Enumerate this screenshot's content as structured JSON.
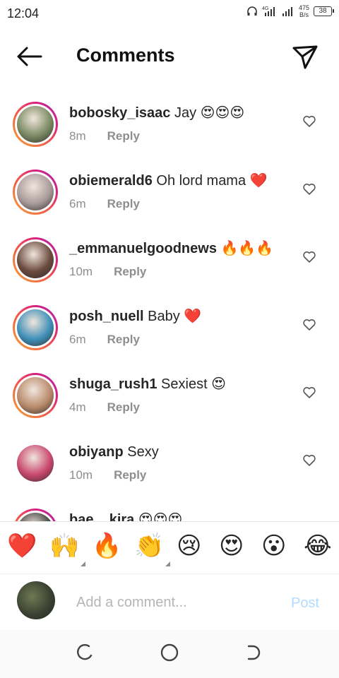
{
  "status_bar": {
    "time": "12:04",
    "network": "4G",
    "speed_value": "475",
    "speed_unit": "B/s",
    "battery": "38"
  },
  "header": {
    "title": "Comments",
    "back_icon": "arrow-left-icon",
    "share_icon": "paper-plane-icon"
  },
  "comments": [
    {
      "username": "bobosky_isaac",
      "text": " Jay 😍😍😍",
      "time": "8m",
      "reply": "Reply",
      "story_ring": true,
      "avatar_color": "#7a8a63"
    },
    {
      "username": "obiemerald6",
      "text": " Oh lord mama ❤️",
      "time": "6m",
      "reply": "Reply",
      "story_ring": true,
      "avatar_color": "#a89a9a"
    },
    {
      "username": "_emmanuelgoodnews",
      "text": " 🔥🔥🔥",
      "time": "10m",
      "reply": "Reply",
      "story_ring": true,
      "avatar_color": "#6b4a3e"
    },
    {
      "username": "posh_nuell",
      "text": " Baby ❤️",
      "time": "6m",
      "reply": "Reply",
      "story_ring": true,
      "avatar_color": "#3f8fb8"
    },
    {
      "username": "shuga_rush1",
      "text": " Sexiest 😍",
      "time": "4m",
      "reply": "Reply",
      "story_ring": true,
      "avatar_color": "#b98a6b"
    },
    {
      "username": "obiyanp",
      "text": " Sexy",
      "time": "10m",
      "reply": "Reply",
      "story_ring": false,
      "avatar_color": "#c9476e"
    },
    {
      "username": "bae__kira",
      "text": " 😍😍😍",
      "time": "",
      "reply": "",
      "story_ring": true,
      "avatar_color": "#444444"
    }
  ],
  "quick_emojis": [
    "❤️",
    "🙌",
    "🔥",
    "👏",
    "😢",
    "😍",
    "😮",
    "😂"
  ],
  "compose": {
    "placeholder": "Add a comment...",
    "post_label": "Post"
  },
  "nav": {
    "back_icon": "recents-icon",
    "home_icon": "home-circle-icon",
    "recent_icon": "back-icon"
  }
}
